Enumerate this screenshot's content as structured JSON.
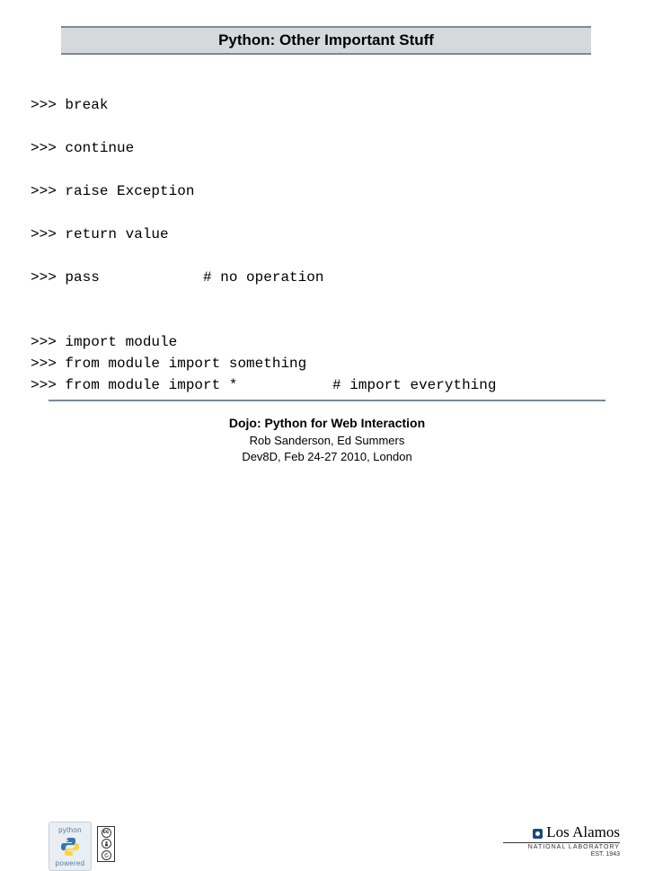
{
  "title": "Python: Other Important Stuff",
  "code_lines": [
    ">>> break",
    "",
    ">>> continue",
    "",
    ">>> raise Exception",
    "",
    ">>> return value",
    "",
    ">>> pass            # no operation",
    "",
    "",
    ">>> import module",
    ">>> from module import something",
    ">>> from module import *           # import everything"
  ],
  "footer": {
    "title": "Dojo: Python for Web Interaction",
    "authors": "Rob Sanderson, Ed Summers",
    "event": "Dev8D, Feb 24-27 2010, London"
  },
  "logos": {
    "python_top": "python",
    "python_bottom": "powered",
    "cc_top": "cc",
    "la_name": "Los Alamos",
    "la_sub": "NATIONAL LABORATORY",
    "la_est": "EST. 1943"
  }
}
